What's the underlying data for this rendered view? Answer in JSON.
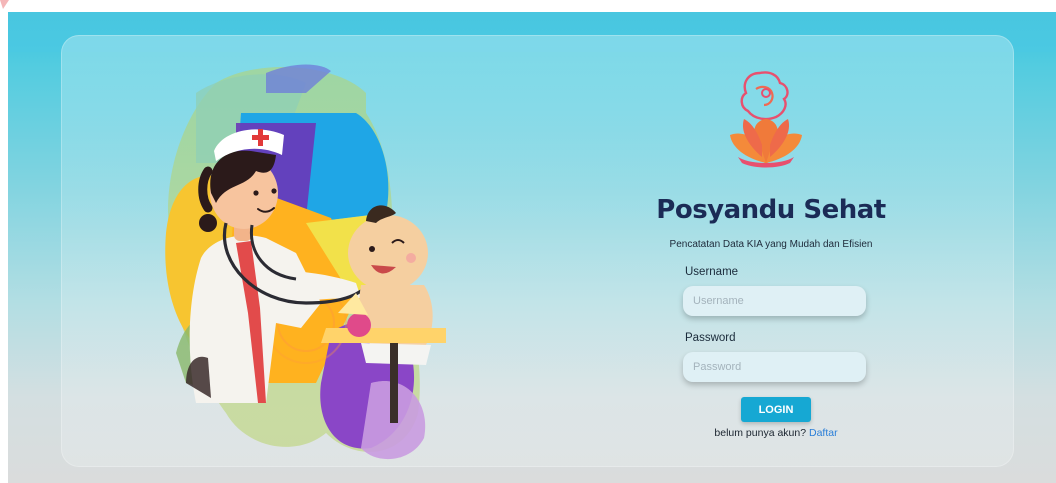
{
  "app": {
    "title": "Posyandu Sehat",
    "subtitle": "Pencatatan Data KIA yang Mudah dan Efisien"
  },
  "login_form": {
    "username_label": "Username",
    "username_placeholder": "Username",
    "username_value": "",
    "password_label": "Password",
    "password_placeholder": "Password",
    "password_value": "",
    "login_button": "LOGIN",
    "register_prompt": "belum punya akun?",
    "register_link": "Daftar"
  },
  "icons": {
    "logo": "mother-child-lotus-logo",
    "illustration": "doctor-examining-baby-illustration"
  },
  "colors": {
    "accent": "#16a8d3",
    "title": "#1b2b56",
    "link": "#2a7ed8",
    "logo_orange": "#f07a3a",
    "logo_pink": "#e85b7a"
  }
}
